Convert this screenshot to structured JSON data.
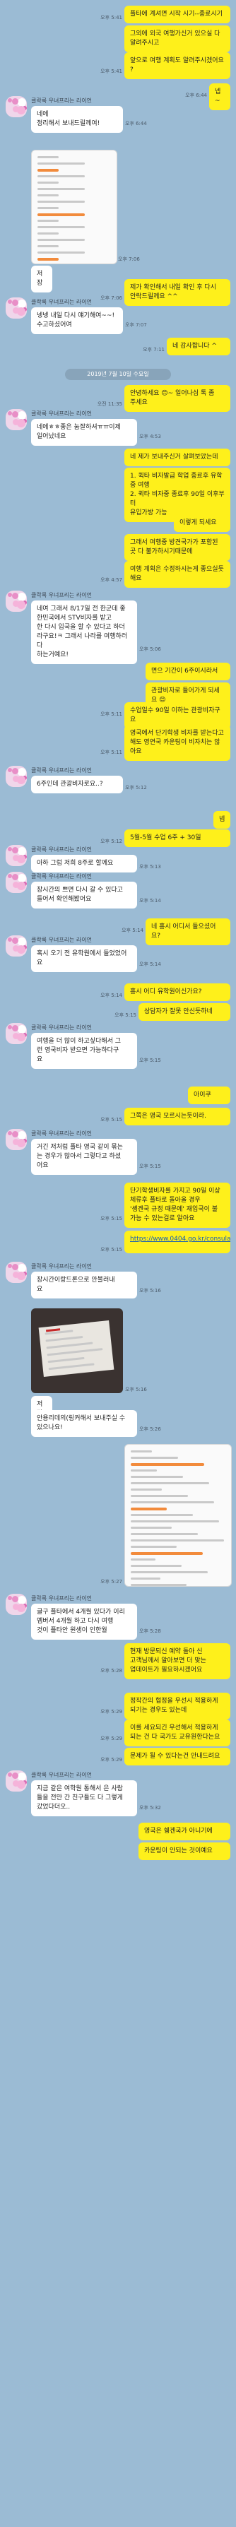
{
  "partner_name": "클락룩 우녀프리는 라이언",
  "date_separator": "2019년 7월 10일 수요일",
  "messages": [
    {
      "side": "me",
      "text": "플타에 계셔면 시작 시기--종료시기",
      "time": "오후 5:41"
    },
    {
      "side": "me",
      "text": "그외에 외국 여행가신거 있으실 다\n알려주시고",
      "time": ""
    },
    {
      "side": "me",
      "text": "앞으로 여행 계획도 알려주시겠어요\n?",
      "time": "오후 5:41"
    },
    {
      "side": "me",
      "text": "넵~",
      "time": "오후 6:44"
    },
    {
      "side": "other",
      "text": "네에\n정리해서 보내드릴께여!",
      "time": "오후 6:44"
    },
    {
      "side": "other",
      "image": "screenshot",
      "time": "오후 7:06"
    },
    {
      "side": "other",
      "text": "저장",
      "time": ""
    },
    {
      "side": "me",
      "text": "제가 확인해서 내일 확인 후 다시\n안락드릴께요 ^^",
      "time": "오후 7:06"
    },
    {
      "side": "other",
      "text": "넹넹 내일 다시 얘기해여~~!\n수고하셨어여",
      "time": "오후 7:07"
    },
    {
      "side": "me",
      "text": "네 감사합니다 ^",
      "time": "오후 7:11"
    },
    {
      "side": "me",
      "text": "안녕하세요 😊~ 일어나심 톡 좀\n주세요",
      "time": "오전 11:35"
    },
    {
      "side": "other",
      "text": "네에ㅎㅎ좋은 눔잘하셔ㅠㅠ이제\n일어났네요",
      "time": "오후 4:53"
    },
    {
      "side": "me",
      "text": "네 제가 보내주신거 살펴보았는데",
      "time": ""
    },
    {
      "side": "me",
      "text": "1. 퀵타 비자발급 학업 종료후 유학\n중 여행\n2. 퀵타 비자중 종료후 90일 이후부터\n유입가방 가능",
      "time": ""
    },
    {
      "side": "me",
      "text": "이렇게 되세요",
      "time": ""
    },
    {
      "side": "me",
      "text": "그래서 여행중 방견국가가 포함된\n곳 다 불가하시기때문에",
      "time": ""
    },
    {
      "side": "me",
      "text": "여행 계획은 수정하시는게 좋으실듯\n해요",
      "time": "오후 4:57"
    },
    {
      "side": "other",
      "text": "네여 그래서 8/17일 전 한군데 좋\n한민국에서 STV비자를 받고\n한 다시 입국을 할 수 있다고 하더\n라구요!ㅋ 그래서 나라를 여행하러 다\n하는거예요!",
      "time": "오후 5:06"
    },
    {
      "side": "me",
      "text": "면으 기간이 6주이시라서",
      "time": ""
    },
    {
      "side": "me",
      "text": "관광비자로 들어가게 되세요 😊",
      "time": ""
    },
    {
      "side": "me",
      "text": "수업일수 90일 이하는 관광비자구요",
      "time": "오후 5:11"
    },
    {
      "side": "me",
      "text": "영국에서 단기학생 비자를 받는다고\n해도 영연국 카운팅이 비자치는 않\n아요",
      "time": "오후 5:11"
    },
    {
      "side": "other",
      "text": "6주인데 관광비자로요..?",
      "time": "오후 5:12"
    },
    {
      "side": "me",
      "text": "넵",
      "time": ""
    },
    {
      "side": "me",
      "text": "5월-5월 수업 6주 + 30일",
      "time": "오후 5:12"
    },
    {
      "side": "other",
      "text": "아하 그럼 저희 8주로 할께요",
      "time": "오후 5:13"
    },
    {
      "side": "other",
      "text": "장시간의 쁘면 다시 갈 수 있다고\n들어서 확인해봤어요",
      "time": "오후 5:14"
    },
    {
      "side": "me",
      "text": "네 홍시 어디서 들으셨어요?",
      "time": "오후 5:14"
    },
    {
      "side": "other",
      "text": "혹시 오기 전 유학원에서 들었었어\n요",
      "time": "오후 5:14"
    },
    {
      "side": "me",
      "text": "홍시 어디 유학원이신가요?",
      "time": "오후 5:14"
    },
    {
      "side": "me",
      "text": "상담자가 잘못 안신듯하네",
      "time": "오후 5:15"
    },
    {
      "side": "other",
      "text": "여행을 더 많이 하고싶다해서 그\n런 영국비자 받으면 가능하다구\n요",
      "time": "오후 5:15"
    },
    {
      "side": "me",
      "text": "아이쿠",
      "time": ""
    },
    {
      "side": "me",
      "text": "그쪽은 영국 모르시는듯이라.",
      "time": "오후 5:15"
    },
    {
      "side": "other",
      "text": "거긴 저처럼 플타 영국 같이 묶는\n는 경우가 많아서 그렇다고 하셨\n어요",
      "time": "오후 5:15"
    },
    {
      "side": "me",
      "text": "단기학생비자를 가지고 90일 이상\n체류후 플타로 돌아올 경우\n'솅겐국 규정 때문에' 재입국이 불\n가능 수 있는걸로 알아요",
      "time": "오후 5:15"
    },
    {
      "side": "me",
      "text": "https://www.0404.go.kr/consulate/visa_treaty.jsp",
      "time": "오후 5:15"
    },
    {
      "side": "other",
      "text": "장시간이랑드론으로 안불러내\n요",
      "time": "오후 5:16"
    },
    {
      "side": "other",
      "image": "photo",
      "time": "오후 5:16"
    },
    {
      "side": "other",
      "text": "저장",
      "time": ""
    },
    {
      "side": "other",
      "text": "안용리데의(링커해서 보내주실 수\n있으나요!",
      "time": "오후 5:26"
    },
    {
      "side": "me",
      "image": "screenshot2",
      "time": "오후 5:27"
    },
    {
      "side": "other",
      "text": "글구 플타에서 4개월 있다가 이리\n멤버서 4개월 하고 다시 여행\n것이 플타안 원생이 인한월",
      "time": "오후 5:28"
    },
    {
      "side": "me",
      "text": "현재 방문되신 예약 돌아 신\n고객님께서 알아보면 더 맞는\n업데이트가 필요하시겠어요",
      "time": "오후 5:28"
    },
    {
      "side": "me",
      "text": "정작간의 협정을 우선시 적용하게\n되기는 경우도 있는데",
      "time": "오후 5:29"
    },
    {
      "side": "me",
      "text": "이를 세요되긴 우선해서 적용하게\n되는 건 다 국가도 교유원한다는요",
      "time": "오후 5:29"
    },
    {
      "side": "me",
      "text": "문제가 될 수 있다는건 안내드려요",
      "time": "오후 5:29"
    },
    {
      "side": "other",
      "text": "지금 같은 여학원 통해서 은 사람\n들을 전만 간 친구들도 다 그렇게\n갔었다더오..",
      "time": "오후 5:32"
    },
    {
      "side": "me",
      "text": "영국은 쉥겐국가 아니기에",
      "time": ""
    },
    {
      "side": "me",
      "text": "카운팅이 안되는 것이예요",
      "time": ""
    }
  ]
}
